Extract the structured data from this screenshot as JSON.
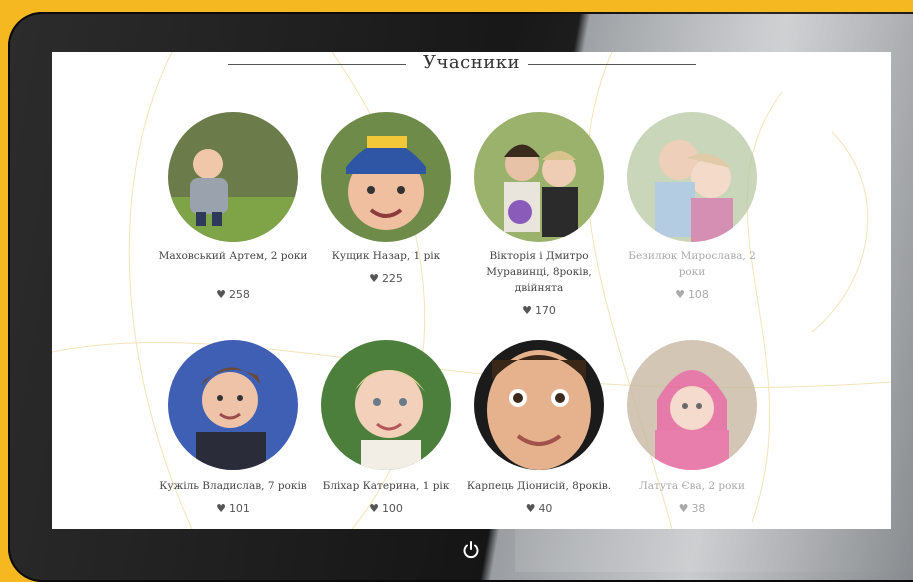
{
  "section_title": "Учасники",
  "participants": [
    {
      "name": "Маховський Артем, 2 роки",
      "likes": "258"
    },
    {
      "name": "Кущик Назар, 1 рік",
      "likes": "225"
    },
    {
      "name": "Вікторія і Дмитро Муравинці, 8років, двійнята",
      "likes": "170"
    },
    {
      "name": "Безилюк Мирослава, 2 роки",
      "likes": "108"
    },
    {
      "name": "Кужіль Владислав, 7 років",
      "likes": "101"
    },
    {
      "name": "Бліхар Катерина, 1 рік",
      "likes": "100"
    },
    {
      "name": "Карпець Діонисій, 8років.",
      "likes": "40"
    },
    {
      "name": "Латута Єва, 2 роки",
      "likes": "38"
    }
  ],
  "colors": {
    "background": "#f6b820",
    "screen": "#ffffff",
    "text": "#444444"
  },
  "icons": {
    "like": "heart-icon",
    "power": "power-icon"
  }
}
